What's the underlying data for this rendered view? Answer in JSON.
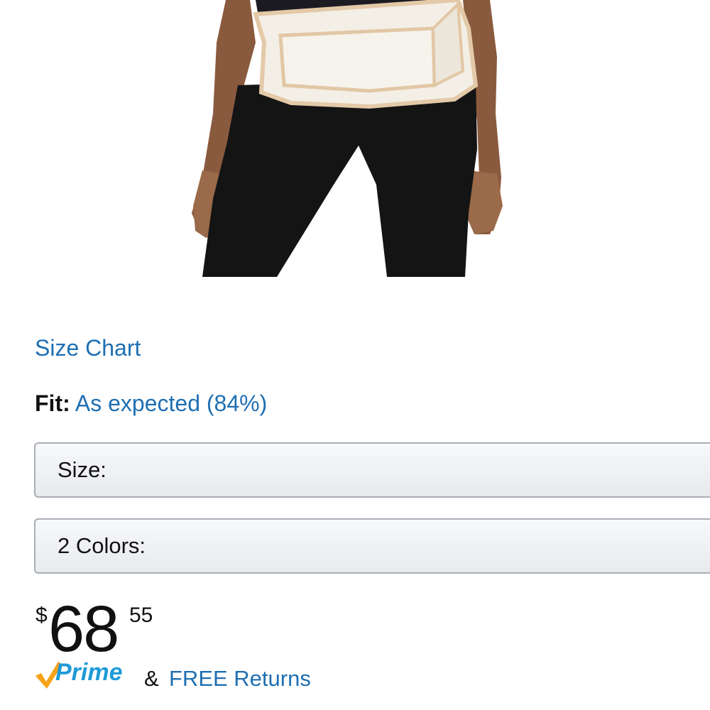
{
  "product": {
    "image_alt": "Maternity support belt worn by model"
  },
  "links": {
    "size_chart": "Size Chart"
  },
  "fit": {
    "label": "Fit:",
    "value": "As expected (84%)"
  },
  "selectors": {
    "size_label": "Size:",
    "colors_label": "2 Colors:"
  },
  "price": {
    "currency": "$",
    "whole": "68",
    "fraction": "55"
  },
  "shipping": {
    "prime_label": "Prime",
    "amp": "&",
    "returns": "FREE Returns"
  },
  "colors": {
    "link": "#1f6fb2",
    "prime_check": "#f7a21b",
    "prime_text": "#1f9bd7",
    "text": "#111111"
  }
}
